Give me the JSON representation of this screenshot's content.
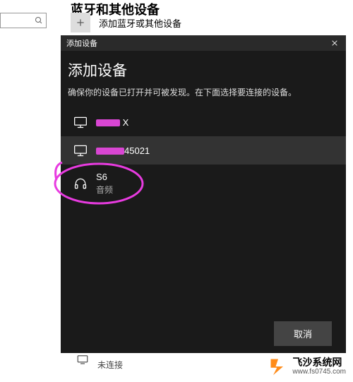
{
  "background": {
    "page_title": "蓝牙和其他设备",
    "add_label": "添加蓝牙或其他设备",
    "bottom_status": "未连接",
    "search_placeholder": ""
  },
  "modal": {
    "titlebar": "添加设备",
    "heading": "添加设备",
    "sub": "确保你的设备已打开并可被发现。在下面选择要连接的设备。",
    "devices": [
      {
        "name_suffix": " X",
        "sub": "",
        "icon": "display"
      },
      {
        "name_suffix": "45021",
        "sub": "",
        "icon": "display"
      },
      {
        "name": "S6",
        "sub": "音频",
        "icon": "headset"
      }
    ],
    "cancel": "取消"
  },
  "watermark": {
    "name": "飞沙系统网",
    "url": "www.fs0745.com"
  }
}
